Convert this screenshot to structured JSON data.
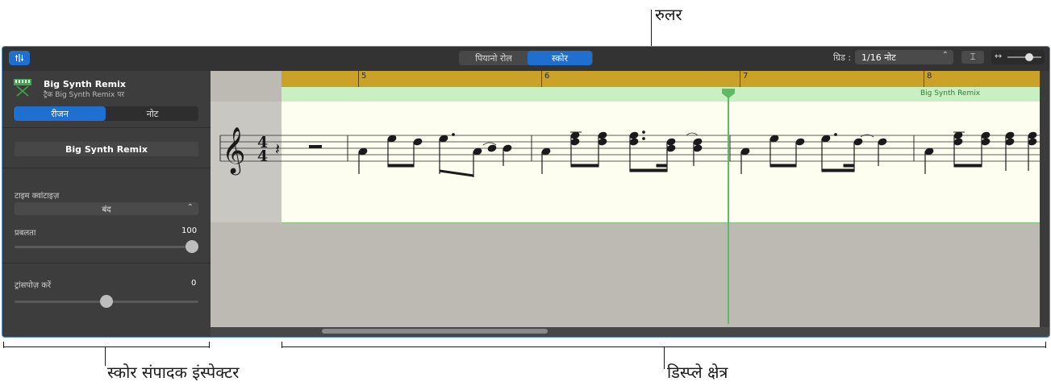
{
  "callouts": {
    "ruler": "रुलर",
    "inspector": "स्कोर संपादक इंस्पेक्टर",
    "display_area": "डिस्प्ले क्षेत्र"
  },
  "toolbar": {
    "piano_roll_label": "पियानो रोल",
    "score_label": "स्कोर",
    "grid_label": "ग्रिड :",
    "grid_value": "1/16 नोट",
    "catch_button_label": "⌶",
    "active_view": "score"
  },
  "inspector": {
    "region_title": "Big Synth Remix",
    "region_subtitle": "ट्रैक Big Synth Remix पर",
    "tab_region": "रीजन",
    "tab_note": "नोट",
    "active_tab": "region",
    "region_name_value": "Big Synth Remix",
    "time_quantize_label": "टाइम क्वांटाइज़",
    "time_quantize_value": "बंद",
    "strength_label": "प्रबलता",
    "strength_value": "100",
    "strength_fraction": 1.0,
    "transpose_label": "ट्रांसपोज़ करें",
    "transpose_value": "0",
    "transpose_fraction": 0.5
  },
  "display": {
    "bar_numbers": [
      "5",
      "6",
      "7",
      "8"
    ],
    "region_name": "Big Synth Remix",
    "time_signature_top": "4",
    "time_signature_bottom": "4"
  },
  "colors": {
    "accent": "#1f6fd1",
    "ruler": "#c9a227",
    "region": "#c8f0c3",
    "playhead": "#63b863"
  }
}
